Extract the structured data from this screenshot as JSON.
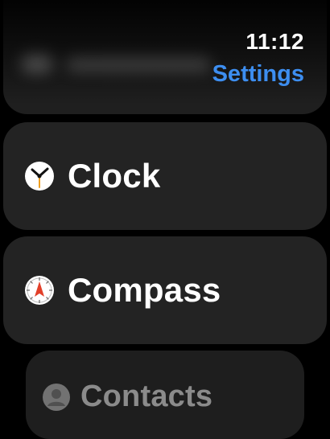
{
  "status": {
    "time": "11:12"
  },
  "nav": {
    "back_title": "Settings"
  },
  "list": {
    "items": [
      {
        "label": "Clock",
        "icon": "clock-icon"
      },
      {
        "label": "Compass",
        "icon": "compass-icon"
      },
      {
        "label": "Contacts",
        "icon": "contacts-icon"
      }
    ]
  },
  "colors": {
    "accent": "#3d8ef0",
    "cell_background": "#232323",
    "background": "#000000"
  }
}
